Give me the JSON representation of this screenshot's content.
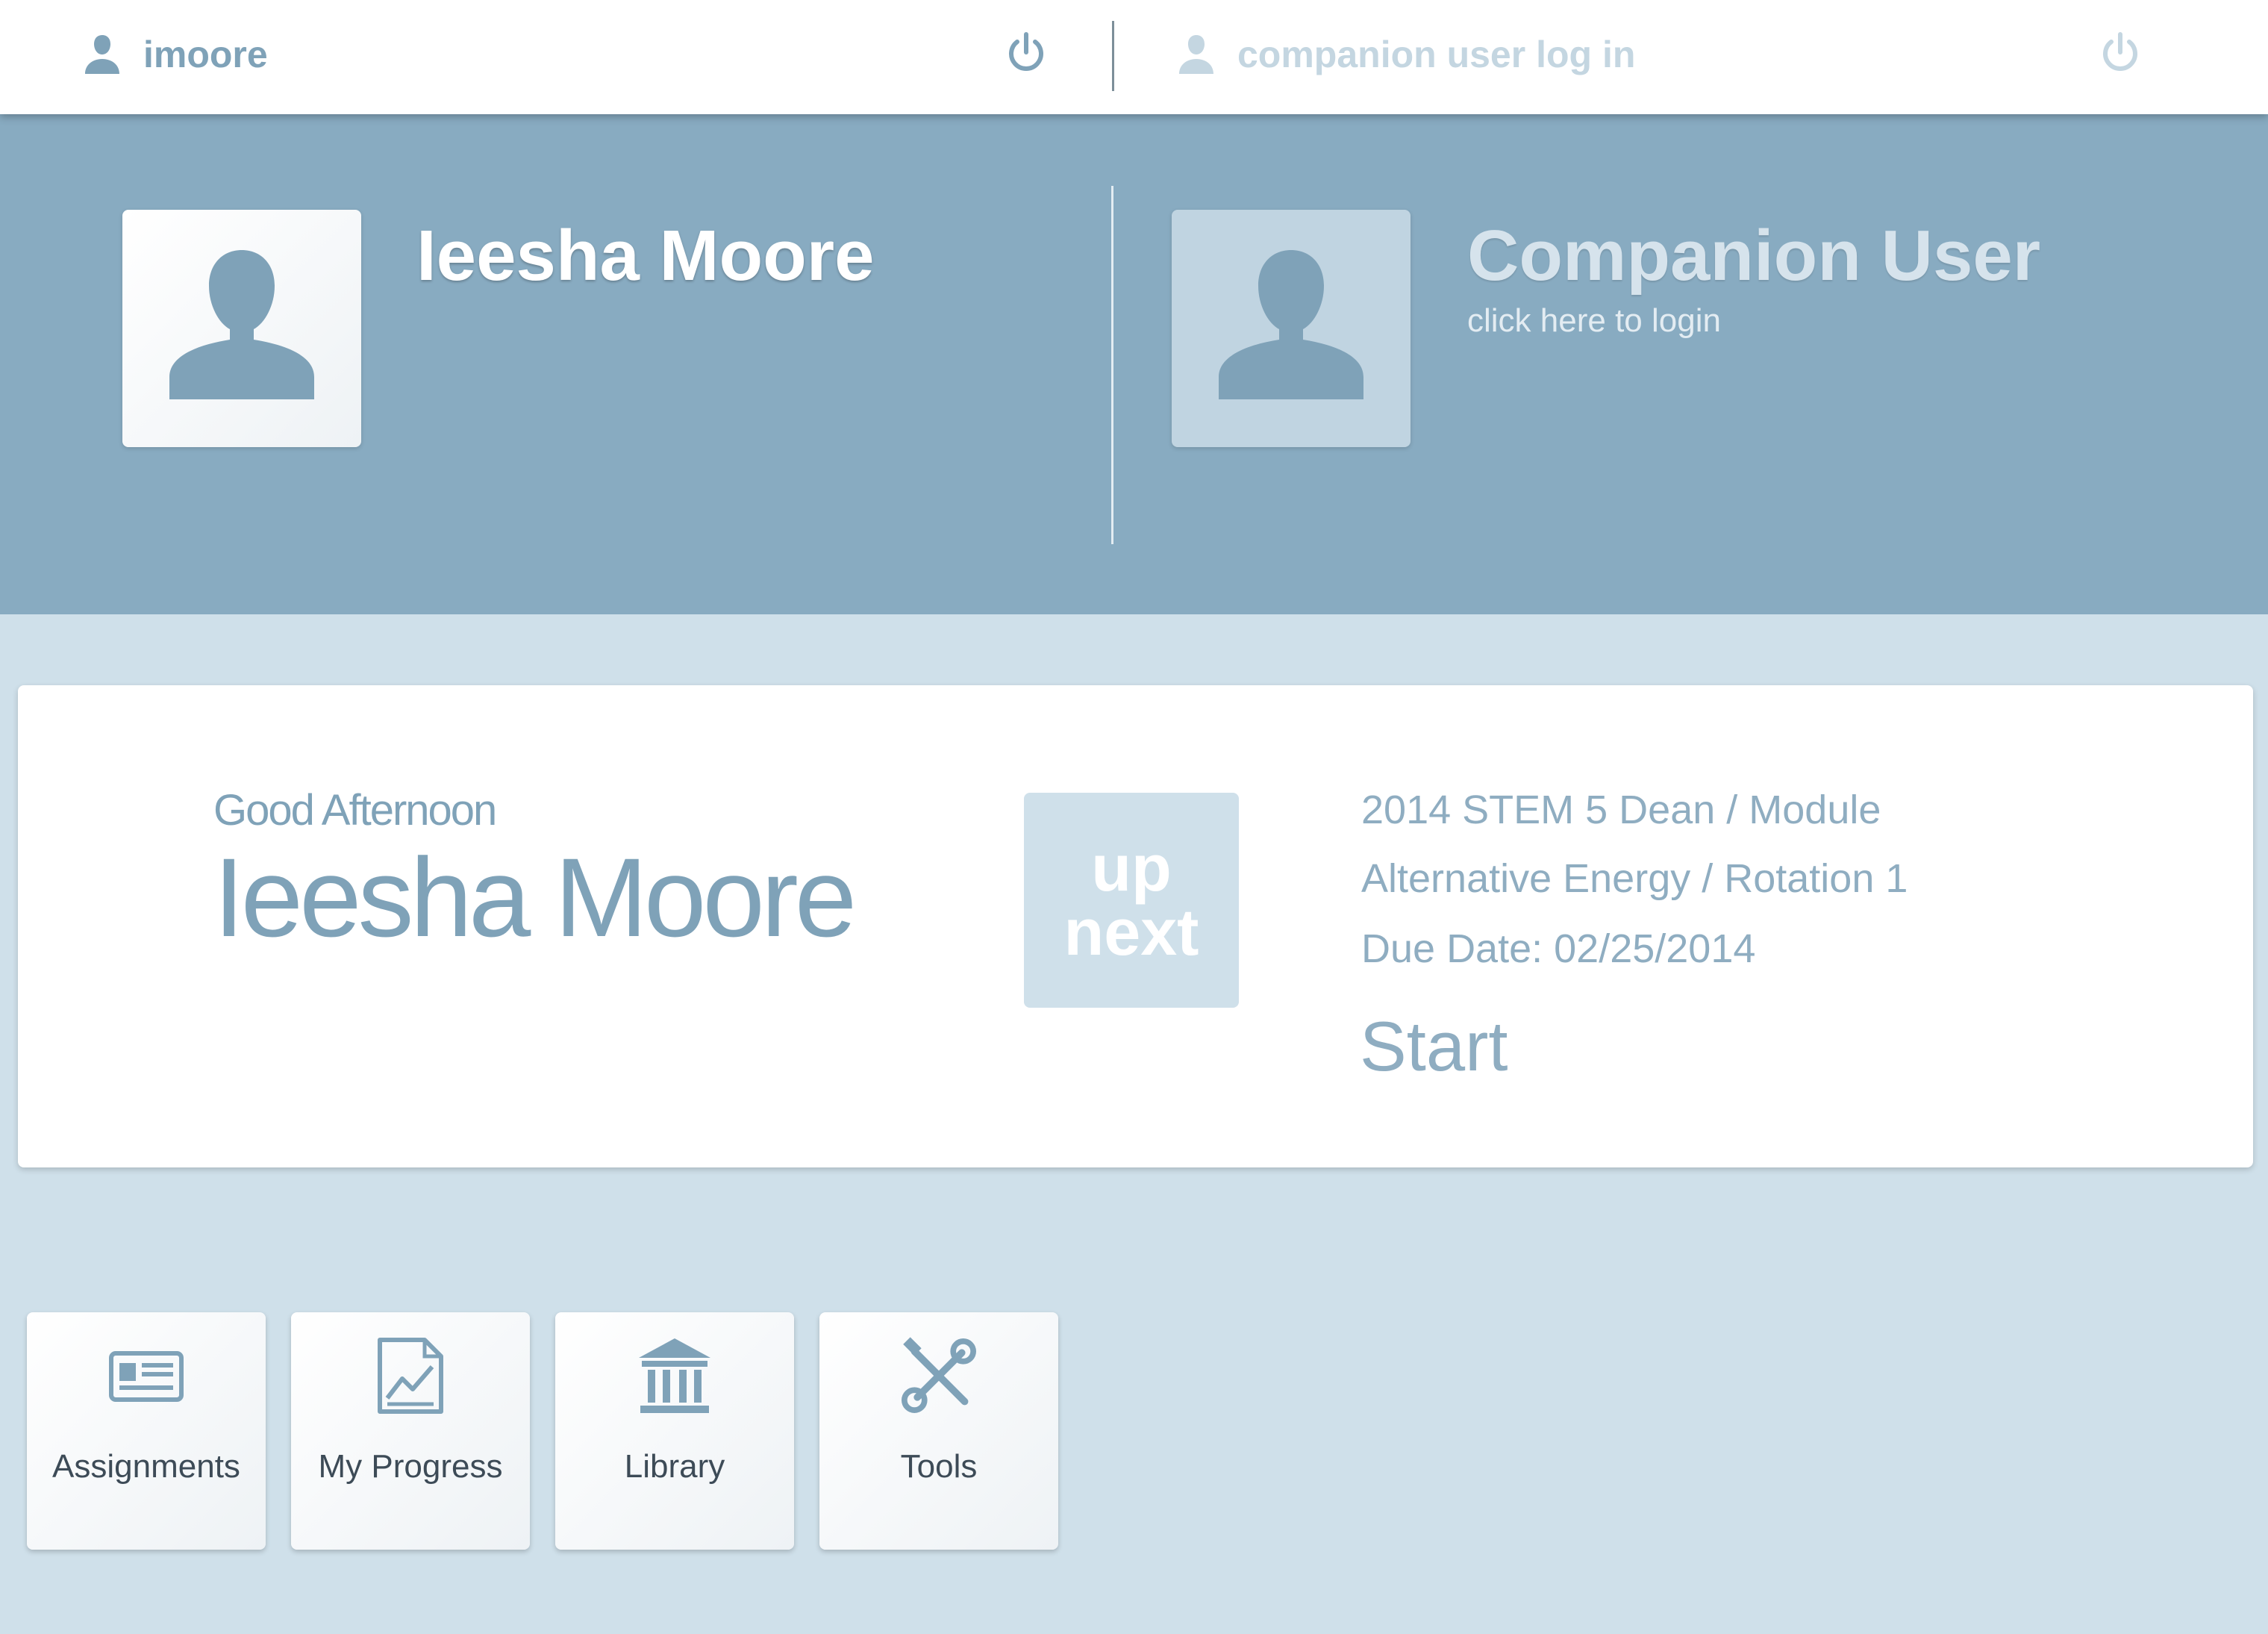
{
  "topbar": {
    "primary_user": "imoore",
    "companion_user": "companion user log in"
  },
  "banner": {
    "primary_name": "Ieesha Moore",
    "companion_title": "Companion User",
    "companion_subtitle": "click here to login"
  },
  "welcome": {
    "greeting": "Good Afternoon",
    "name": "Ieesha Moore"
  },
  "up_next": {
    "badge_line1": "up",
    "badge_line2": "next",
    "module_path": "2014 STEM 5 Dean / Module",
    "module_detail": "Alternative Energy / Rotation 1",
    "due_date": "Due Date: 02/25/2014",
    "start_label": "Start"
  },
  "tiles": [
    {
      "label": "Assignments",
      "icon": "assignments-icon"
    },
    {
      "label": "My Progress",
      "icon": "progress-chart-icon"
    },
    {
      "label": "Library",
      "icon": "library-icon"
    },
    {
      "label": "Tools",
      "icon": "tools-icon"
    }
  ],
  "colors": {
    "banner": "#88abc1",
    "page_background": "#cfe0ea",
    "accent_text": "#7fa2b8"
  }
}
